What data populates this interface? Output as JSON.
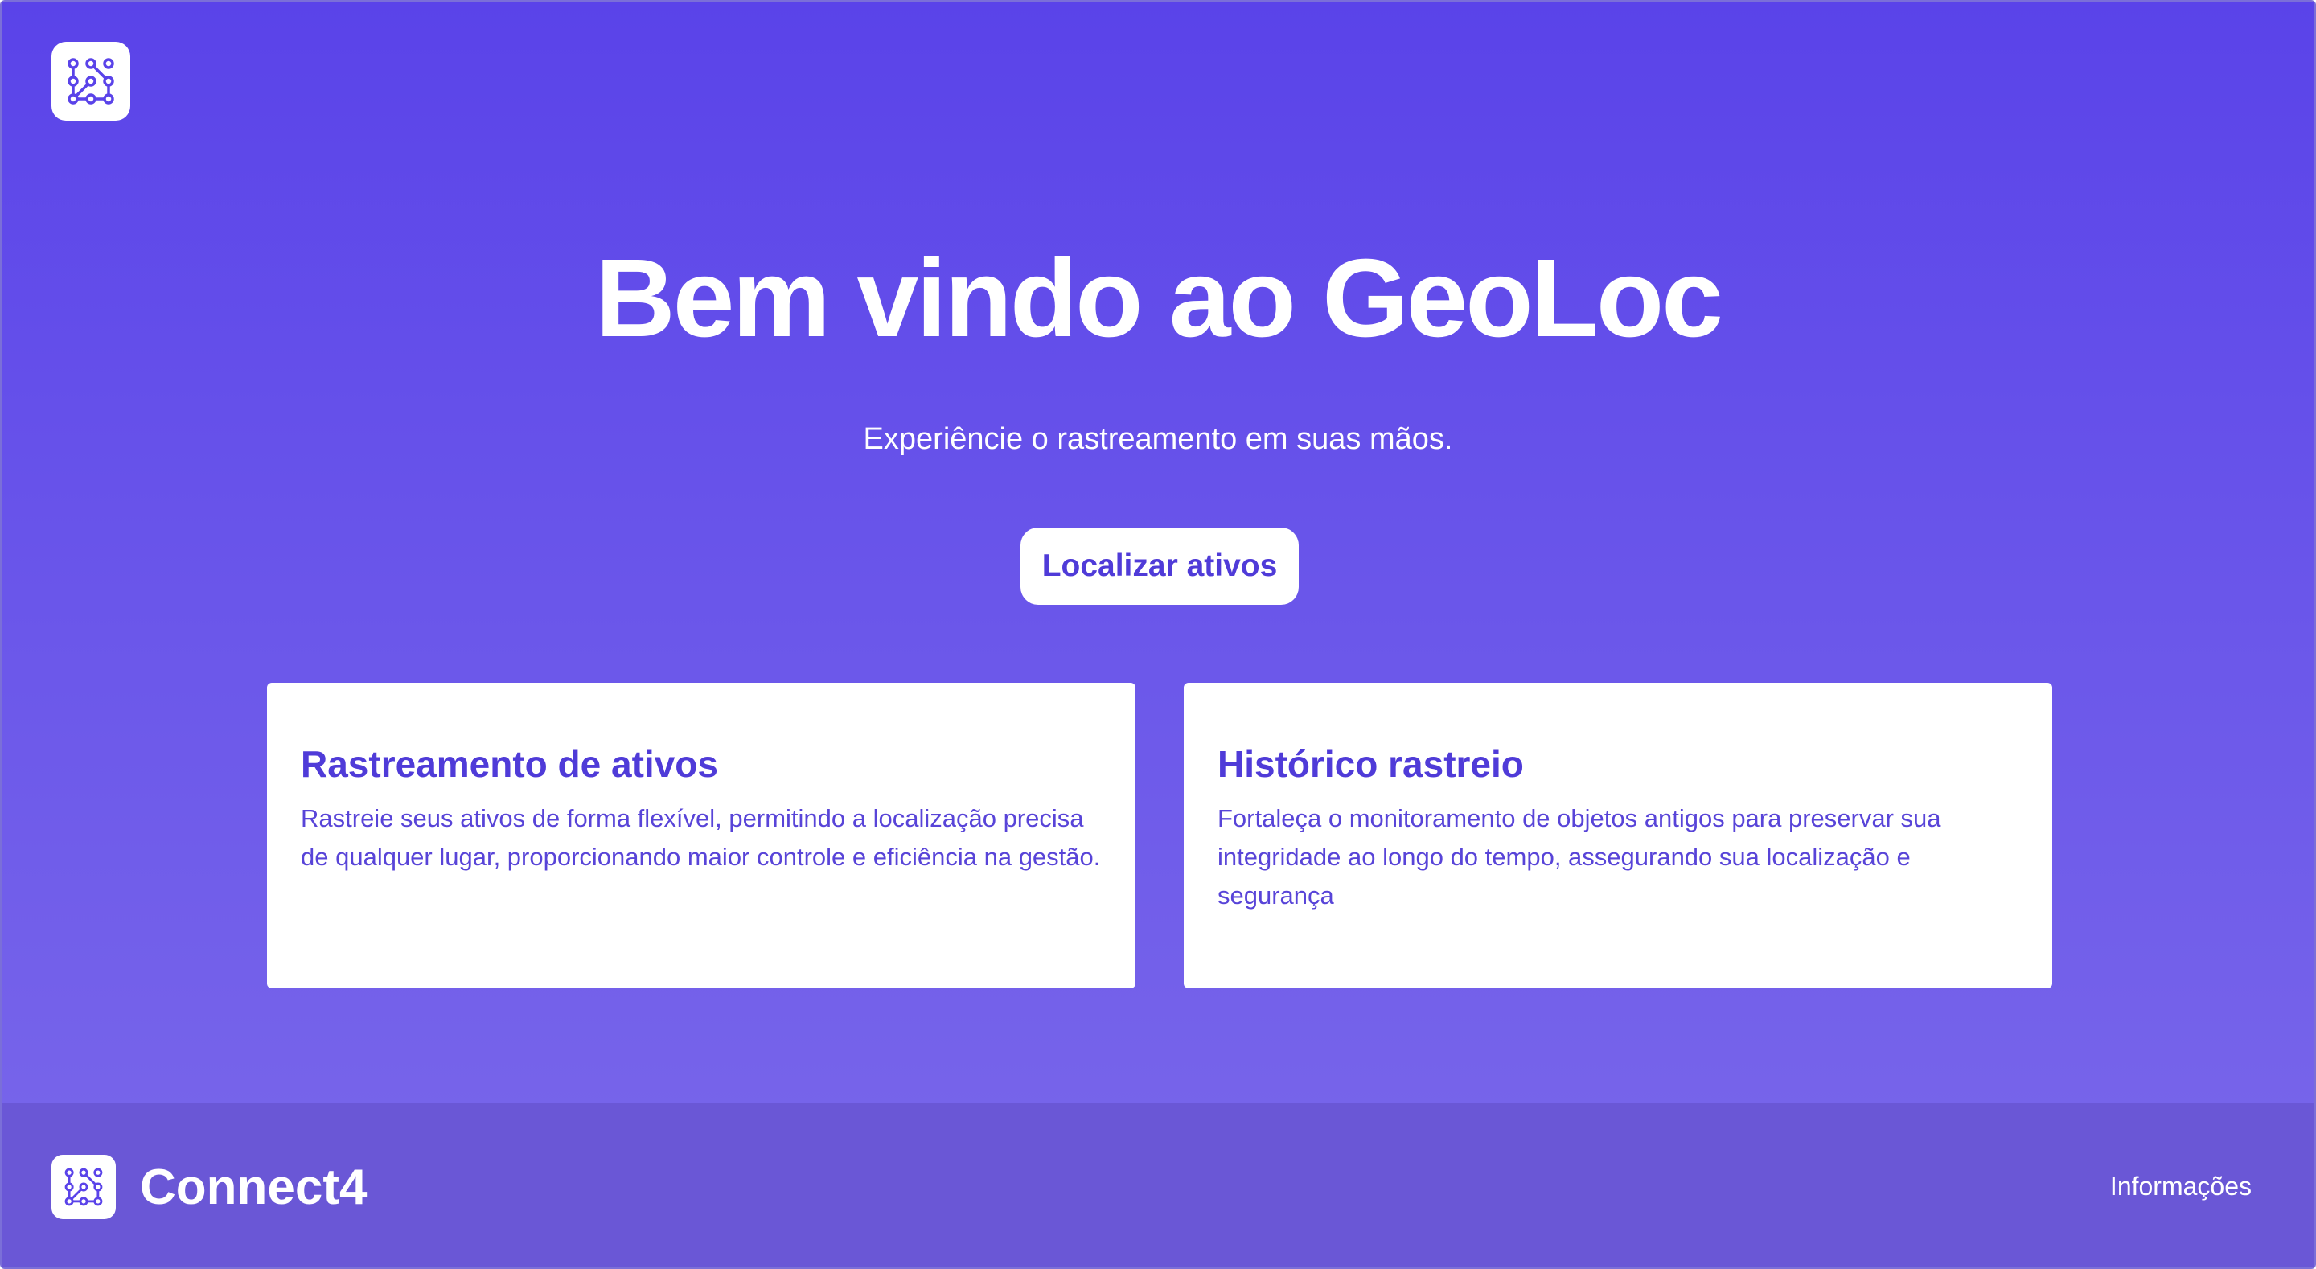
{
  "hero": {
    "title": "Bem vindo ao GeoLoc",
    "subtitle": "Experiêncie o rastreamento em suas mãos.",
    "cta_label": "Localizar ativos"
  },
  "cards": [
    {
      "title": "Rastreamento de ativos",
      "text": "Rastreie seus ativos de forma flexível, permitindo a localização precisa de qualquer lugar, proporcionando maior controle e eficiência na gestão."
    },
    {
      "title": "Histórico rastreio",
      "text": "Fortaleça o monitoramento de objetos antigos para preservar sua integridade ao longo do tempo, assegurando sua localização e segurança"
    }
  ],
  "footer": {
    "brand": "Connect4",
    "link_label": "Informações"
  },
  "icons": {
    "logo": "connect-dots-logo-icon"
  },
  "colors": {
    "accent": "#4f3bd8",
    "background_top": "#5a43e9",
    "background_bottom": "#7a68ea",
    "footer": "#6a57d6",
    "surface": "#ffffff"
  }
}
